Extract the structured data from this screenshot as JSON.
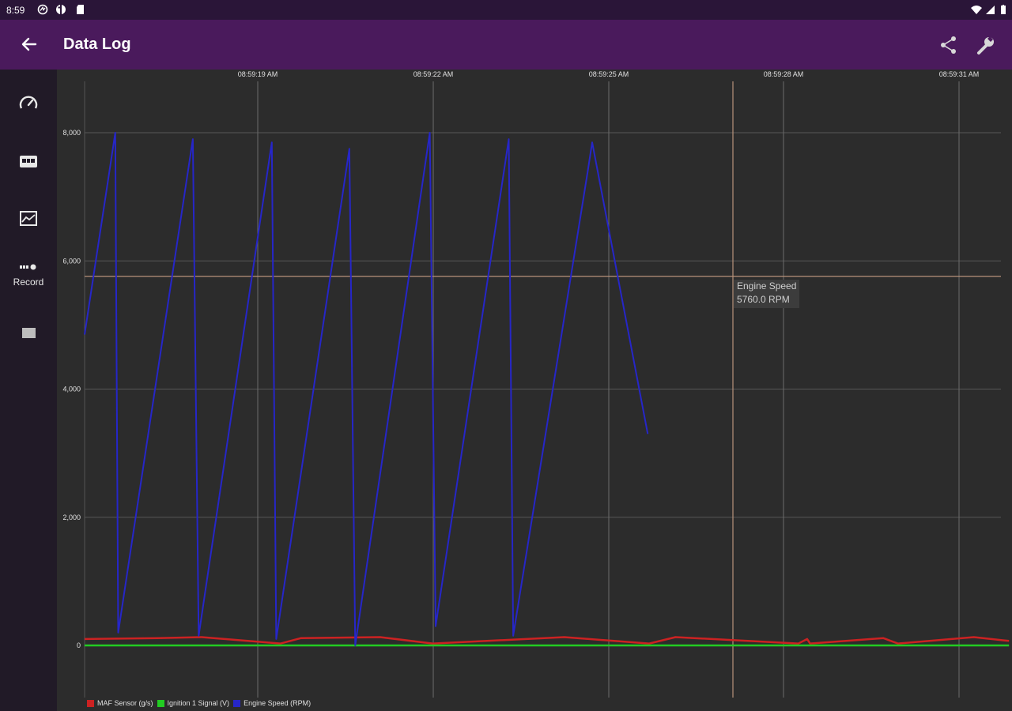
{
  "status_bar": {
    "time": "8:59",
    "icons": [
      "podcast-icon",
      "data-saver-icon",
      "sd-card-icon",
      "wifi-icon",
      "cell-signal-icon",
      "battery-icon"
    ]
  },
  "app_bar": {
    "title": "Data Log",
    "back_icon": "arrow-back-icon",
    "actions": [
      "share-icon",
      "wrench-icon"
    ],
    "background": "#4a1a5c"
  },
  "nav_rail": {
    "items": [
      {
        "icon": "speedometer-icon"
      },
      {
        "icon": "car-dashboard-icon"
      },
      {
        "icon": "line-chart-icon"
      },
      {
        "icon": "record-icon",
        "label": "Record"
      },
      {
        "icon": "stop-icon"
      }
    ]
  },
  "tooltip": {
    "title": "Engine Speed",
    "value": "5760.0 RPM"
  },
  "chart_data": {
    "type": "line",
    "x_tick_labels": [
      "08:59:19 AM",
      "08:59:22 AM",
      "08:59:25 AM",
      "08:59:28 AM",
      "08:59:31 AM"
    ],
    "y_tick_labels": [
      "0",
      "2,000",
      "4,000",
      "6,000",
      "8,000"
    ],
    "ylim": [
      0,
      8000
    ],
    "grid": true,
    "legend_position": "bottom-left",
    "cursor_value": 5760,
    "series": [
      {
        "name": "MAF Sensor (g/s)",
        "color": "#cc2222",
        "x": [
          0,
          2.5,
          4.0,
          6.7,
          7.4,
          10.1,
          11.9,
          16.4,
          19.3,
          20.2,
          24.4,
          24.7,
          24.8,
          27.3,
          27.8,
          30.4,
          31.6
        ],
        "values": [
          100,
          115,
          130,
          30,
          115,
          130,
          30,
          130,
          30,
          130,
          30,
          100,
          30,
          115,
          30,
          130,
          70
        ]
      },
      {
        "name": "Ignition 1 Signal (V)",
        "color": "#22cc22",
        "x": [
          0,
          31.6
        ],
        "values": [
          0,
          0
        ]
      },
      {
        "name": "Engine Speed (RPM)",
        "color": "#2626c8",
        "x": [
          0,
          1.05,
          1.15,
          3.7,
          3.9,
          6.4,
          6.55,
          9.05,
          9.25,
          11.8,
          12.0,
          14.5,
          14.65,
          17.2,
          17.35,
          19.25
        ],
        "values": [
          4850,
          8000,
          200,
          7900,
          150,
          7850,
          100,
          7750,
          0,
          8000,
          300,
          7900,
          150,
          7400,
          7850,
          3300
        ]
      }
    ]
  }
}
